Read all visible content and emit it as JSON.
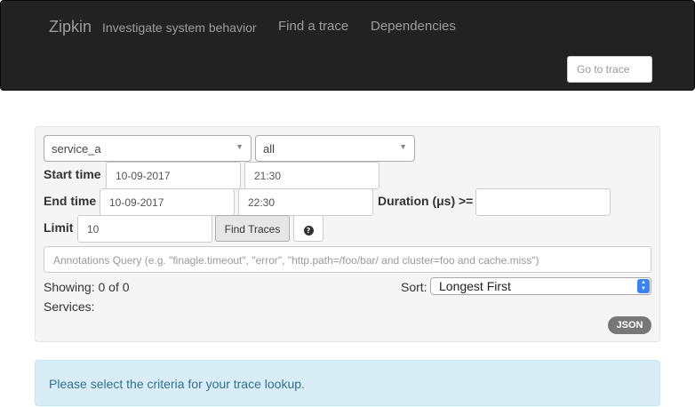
{
  "navbar": {
    "brand": "Zipkin",
    "tagline": "Investigate system behavior",
    "links": [
      "Find a trace",
      "Dependencies"
    ],
    "goto_placeholder": "Go to trace"
  },
  "form": {
    "service": "service_a",
    "span": "all",
    "start_label": "Start time",
    "start_date": "10-09-2017",
    "start_time": "21:30",
    "end_label": "End time",
    "end_date": "10-09-2017",
    "end_time": "22:30",
    "duration_label": "Duration (μs) >=",
    "duration_value": "",
    "limit_label": "Limit",
    "limit_value": "10",
    "find_button": "Find Traces",
    "help_icon": "question-circle-icon",
    "annotations_placeholder": "Annotations Query (e.g. \"finagle.timeout\", \"error\", \"http.path=/foo/bar/ and cluster=foo and cache.miss\")"
  },
  "results": {
    "showing": "Showing: 0 of 0",
    "services": "Services:",
    "sort_label": "Sort:",
    "sort_value": "Longest First",
    "json_badge": "JSON"
  },
  "alert": {
    "message": "Please select the criteria for your trace lookup."
  },
  "colors": {
    "navbar_bg": "#222222",
    "alert_bg": "#d9edf7",
    "alert_text": "#31708f",
    "sort_accent": "#3b82f6"
  }
}
